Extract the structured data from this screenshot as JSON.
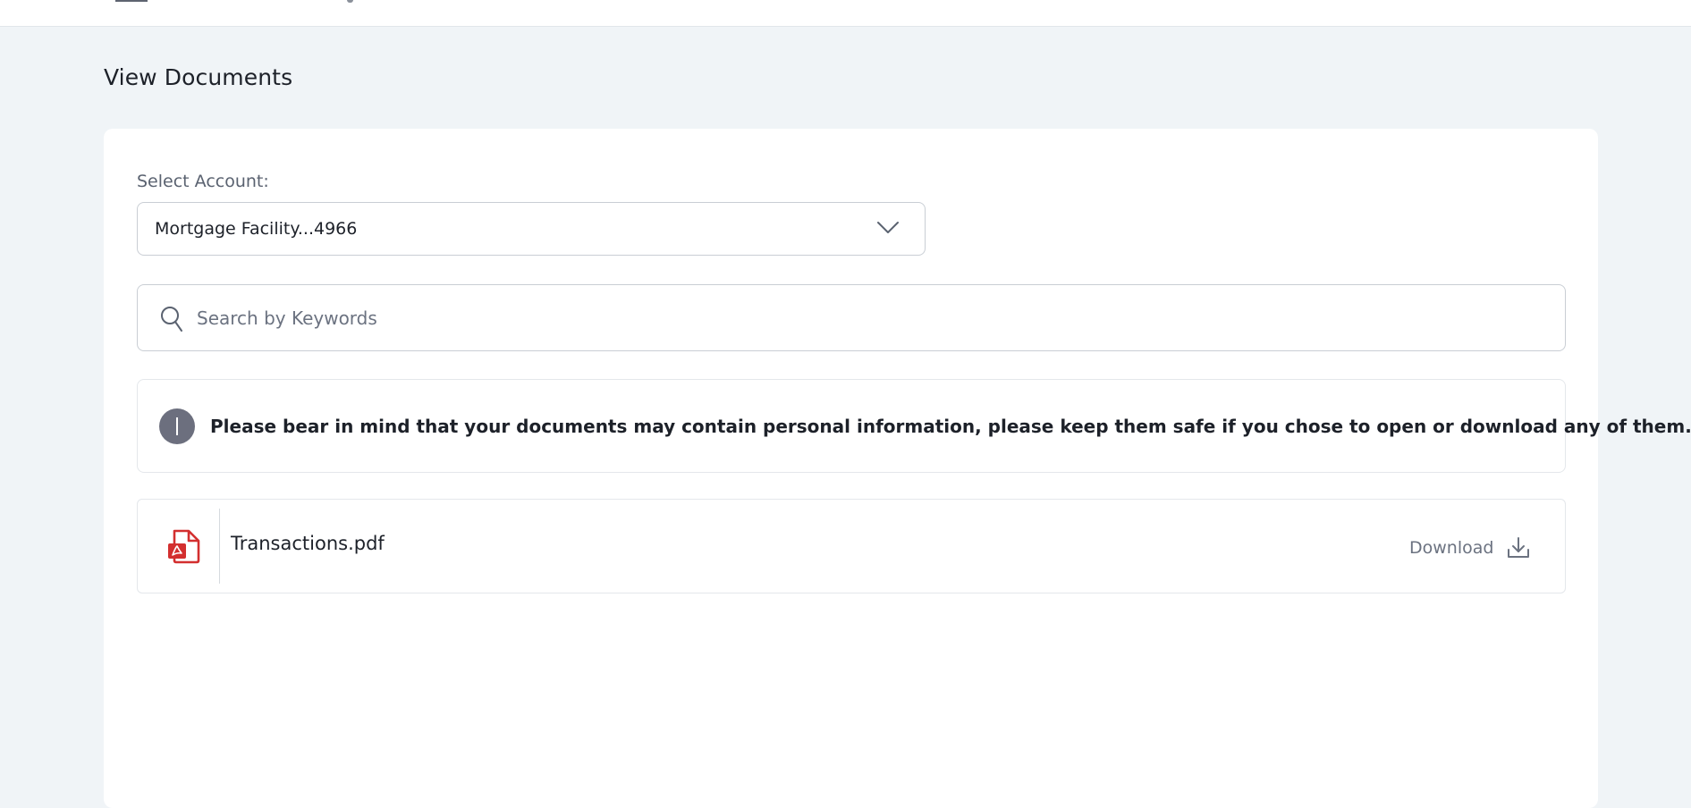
{
  "page": {
    "title": "View Documents"
  },
  "account_select": {
    "label": "Select Account:",
    "selected": "Mortgage Facility...4966"
  },
  "search": {
    "placeholder": "Search by Keywords",
    "value": ""
  },
  "notice": {
    "text": "Please bear in mind that your documents may contain personal information, please keep them safe if you chose to open or download any of them."
  },
  "documents": [
    {
      "name": "Transactions.pdf",
      "action_label": "Download"
    }
  ],
  "colors": {
    "background": "#f0f4f7",
    "card": "#ffffff",
    "pdf_icon": "#d32f2f",
    "info_icon": "#6c6f7e",
    "muted_text": "#6b7280"
  }
}
